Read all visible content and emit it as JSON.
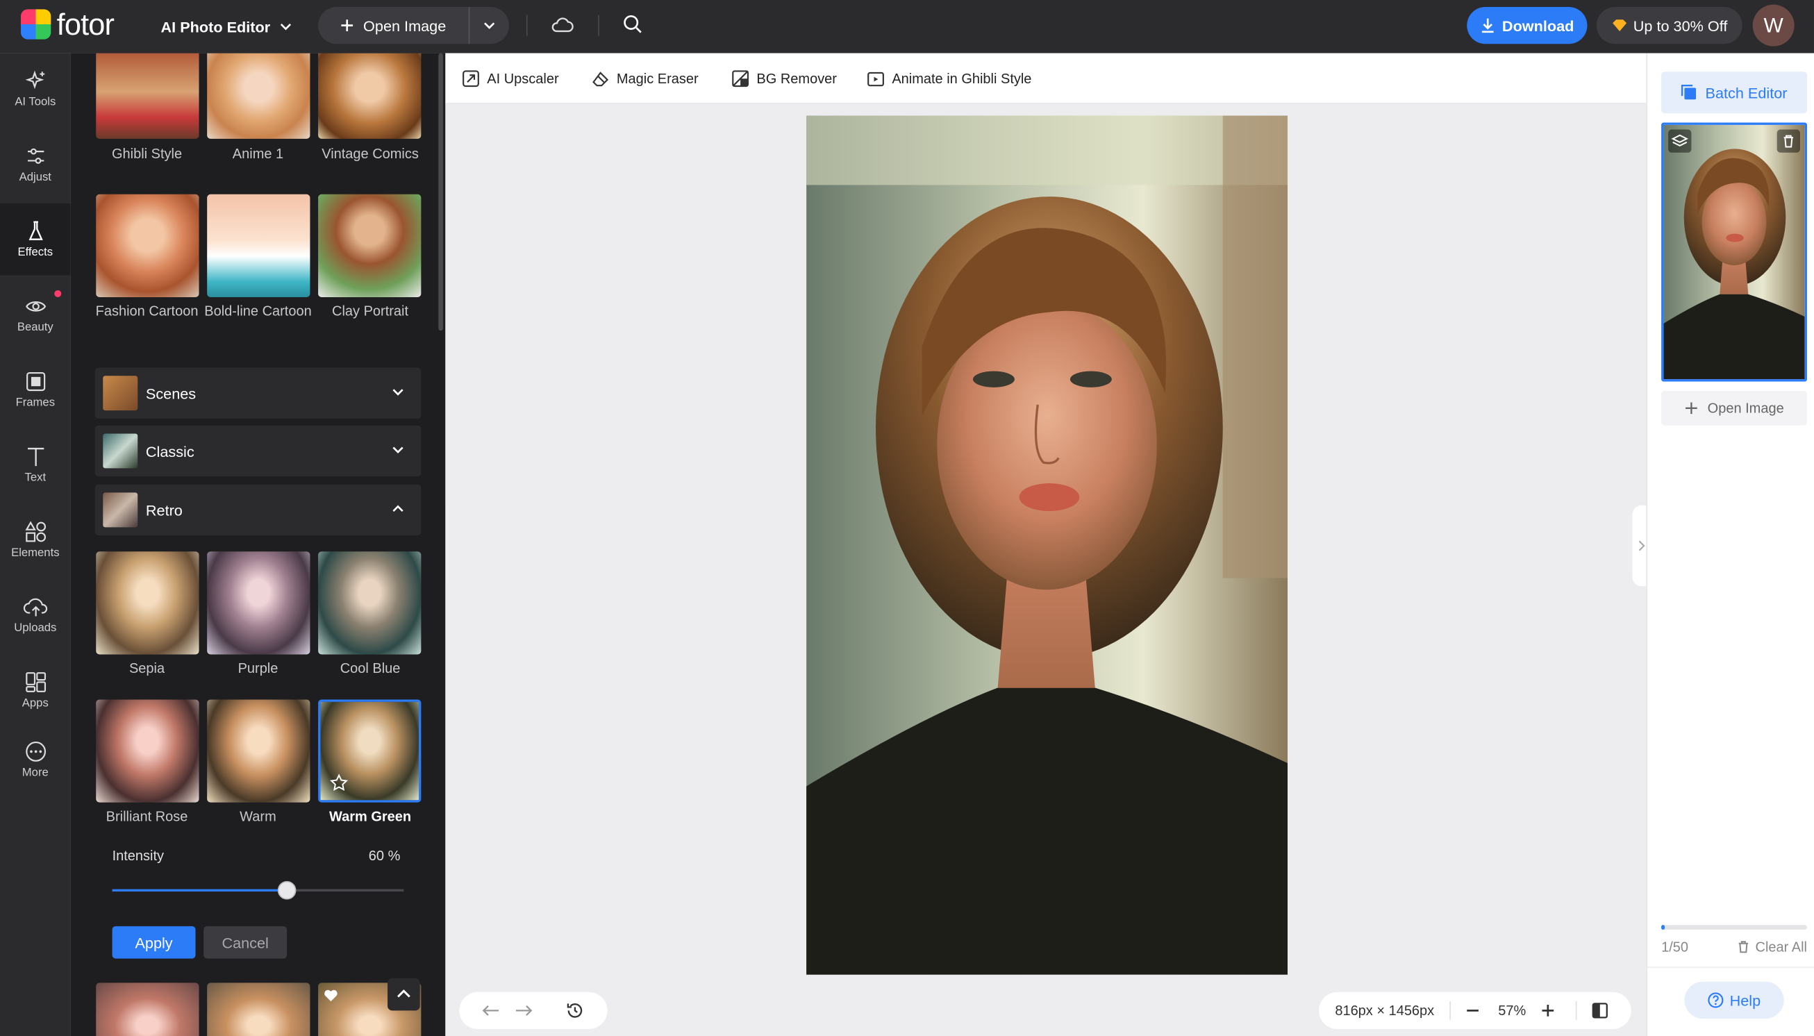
{
  "header": {
    "logo_text": "fotor",
    "editor_menu": "AI Photo Editor",
    "open_image": "Open Image",
    "download": "Download",
    "promo": "Up to 30% Off",
    "avatar_initial": "W"
  },
  "rail": [
    {
      "label": "AI Tools",
      "icon": "sparkle-icon"
    },
    {
      "label": "Adjust",
      "icon": "sliders-icon"
    },
    {
      "label": "Effects",
      "icon": "flask-icon",
      "active": true
    },
    {
      "label": "Beauty",
      "icon": "eye-icon",
      "badge": true
    },
    {
      "label": "Frames",
      "icon": "frame-icon"
    },
    {
      "label": "Text",
      "icon": "text-icon"
    },
    {
      "label": "Elements",
      "icon": "shapes-icon"
    },
    {
      "label": "Uploads",
      "icon": "cloud-upload-icon"
    },
    {
      "label": "Apps",
      "icon": "apps-icon"
    },
    {
      "label": "More",
      "icon": "more-icon"
    }
  ],
  "effects": {
    "ai_styles": [
      "Ghibli Style",
      "Anime 1",
      "Vintage Comics",
      "Fashion Cartoon",
      "Bold-line Cartoon",
      "Clay Portrait"
    ],
    "sections": [
      "Scenes",
      "Classic",
      "Retro"
    ],
    "retro_filters": [
      "Sepia",
      "Purple",
      "Cool Blue",
      "Brilliant Rose",
      "Warm",
      "Warm Green"
    ],
    "selected_filter": "Warm Green",
    "intensity_label": "Intensity",
    "intensity_value": "60 %",
    "intensity": 0.6,
    "apply": "Apply",
    "cancel": "Cancel"
  },
  "toolbar": [
    "AI Upscaler",
    "Magic Eraser",
    "BG Remover",
    "Animate in Ghibli Style"
  ],
  "canvas": {
    "dimensions": "816px × 1456px",
    "zoom": "57%"
  },
  "right_panel": {
    "batch_editor": "Batch Editor",
    "open_image": "Open Image",
    "count": "1/50",
    "clear_all": "Clear All",
    "help": "Help",
    "progress": 0.02
  },
  "colors": {
    "accent": "#2b7cf6",
    "dark": "#2b2b2e",
    "panel": "#1e1e21"
  }
}
